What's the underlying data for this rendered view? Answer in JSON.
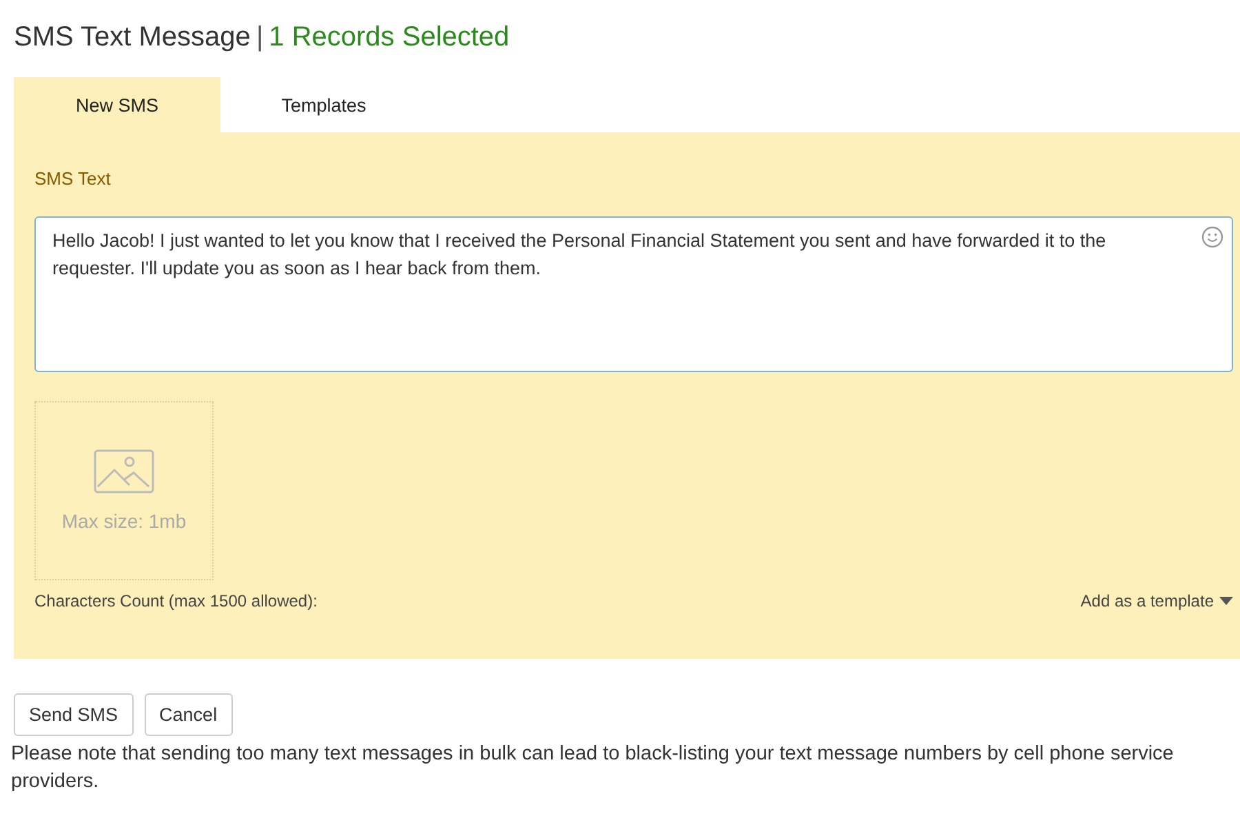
{
  "header": {
    "title": "SMS Text Message",
    "separator": "|",
    "selection": "1 Records Selected"
  },
  "tabs": [
    {
      "label": "New SMS",
      "selected": true
    },
    {
      "label": "Templates",
      "selected": false
    }
  ],
  "form": {
    "label": "SMS Text",
    "message": "Hello Jacob! I just wanted to let you know that I received the Personal Financial Statement you sent and have forwarded it to the requester. I'll update you as soon as I hear back from them.",
    "upload_hint": "Max size: 1mb",
    "count_label": "Characters Count (max 1500 allowed):",
    "template_link": "Add as a template"
  },
  "buttons": [
    "Send SMS",
    "Cancel"
  ],
  "note": "Please note that sending too many text messages in bulk can lead to black-listing your text message numbers by cell phone service providers."
}
